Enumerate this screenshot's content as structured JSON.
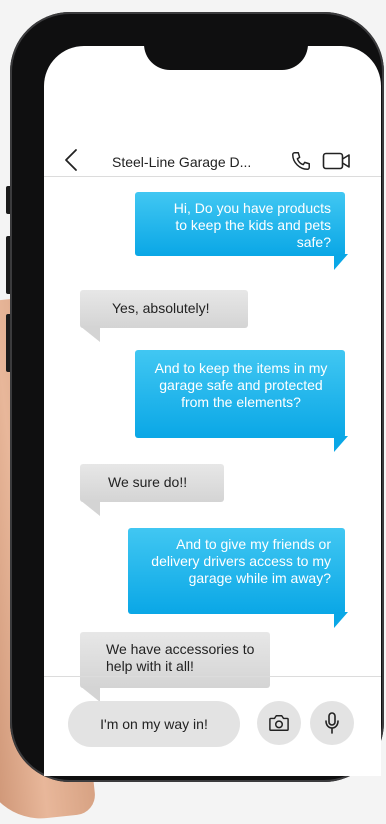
{
  "header": {
    "back_label": "‹",
    "contact_name": "Steel-Line Garage D...",
    "call_icon": "phone-icon",
    "video_icon": "video-camera-icon"
  },
  "messages": [
    {
      "direction": "outgoing",
      "text": "Hi, Do you have products to keep the kids and pets safe?"
    },
    {
      "direction": "incoming",
      "text": "Yes, absolutely!"
    },
    {
      "direction": "outgoing",
      "text": "And to keep the items in my garage safe and protected from the elements?"
    },
    {
      "direction": "incoming",
      "text": "We sure do!!"
    },
    {
      "direction": "outgoing",
      "text": "And to give my friends or delivery drivers access to my garage while im away?"
    },
    {
      "direction": "incoming",
      "text": "We have accessories to help with it all!"
    }
  ],
  "composer": {
    "input_value": "I'm on my way in!",
    "camera_icon": "camera-icon",
    "mic_icon": "microphone-icon"
  },
  "colors": {
    "outgoing_bubble": "#0aa7e6",
    "incoming_bubble": "#d8d8d8",
    "background": "#ffffff"
  }
}
